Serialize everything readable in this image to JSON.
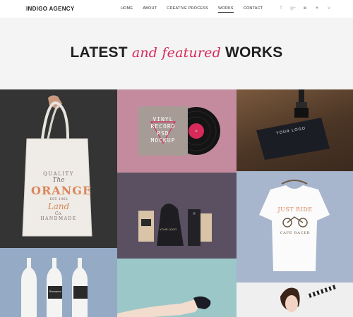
{
  "brand": "INDIGO AGENCY",
  "nav": [
    "HOME",
    "ABOUT",
    "CREATIVE PROCESS",
    "WORKS",
    "CONTACT"
  ],
  "nav_active": "WORKS",
  "social": [
    {
      "icon": "facebook-icon",
      "glyph": "f"
    },
    {
      "icon": "google-plus-icon",
      "glyph": "g+"
    },
    {
      "icon": "instagram-icon",
      "glyph": "◙"
    },
    {
      "icon": "twitter-icon",
      "glyph": "♥"
    },
    {
      "icon": "vimeo-icon",
      "glyph": "v"
    }
  ],
  "hero": {
    "title_part1": "LATEST ",
    "title_accent": "and featured",
    "title_part2": " WORKS",
    "accent_color": "#d72a5a"
  },
  "tiles": {
    "bag": {
      "line1": "QUALITY",
      "line2": "The",
      "line3": "ORANGE",
      "line4": "EST. 1962",
      "line5": "Land",
      "line6": "Co.",
      "line7": "HANDMADE"
    },
    "vinyl": {
      "line1": "VINYL",
      "line2": "RECORD",
      "line3": "PSD",
      "line4": "MOCKUP"
    },
    "card": {
      "line1": "YOUR LOGO"
    },
    "shirt": {
      "line1": "JUST RIDE",
      "line2": "CAFE RACER"
    },
    "bags": {
      "line1": "YOUR LOGO"
    },
    "bottles": {
      "label": "Romance"
    }
  }
}
